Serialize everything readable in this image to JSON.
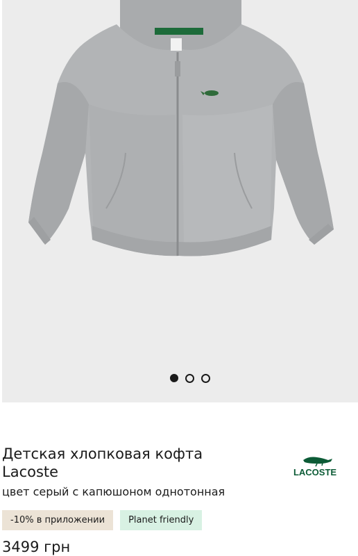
{
  "gallery": {
    "image_alt": "Детская хлопковая кофта Lacoste",
    "slides": [
      {
        "active": true
      },
      {
        "active": false
      },
      {
        "active": false
      }
    ]
  },
  "product": {
    "title": "Детская хлопковая кофта Lacoste",
    "subtitle": "цвет серый с капюшоном однотонная",
    "brand": "LACOSTE",
    "badges": {
      "promo": "-10% в приложении",
      "eco": "Planet friendly"
    },
    "price": "3499 грн"
  },
  "colors": {
    "gallery_bg": "#ececec",
    "promo_badge_bg": "#ece3d6",
    "eco_badge_bg": "#d8f1e3",
    "logo_green": "#0c5b36"
  }
}
